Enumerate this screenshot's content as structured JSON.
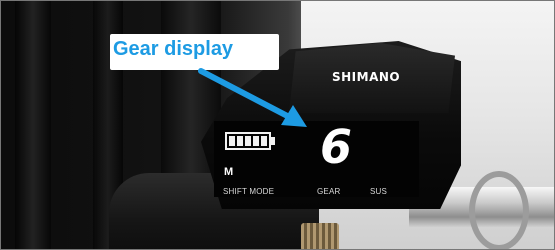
{
  "callout": {
    "label": "Gear display",
    "color": "#1d9be3",
    "arrow_icon": "arrow-icon"
  },
  "device": {
    "brand": "SHIMANO",
    "battery_icon": "battery-icon",
    "battery_level": 1.0,
    "mode": "M",
    "gear": "6",
    "labels": {
      "shift_mode": "SHIFT MODE",
      "gear": "GEAR",
      "sus": "SUS"
    }
  }
}
